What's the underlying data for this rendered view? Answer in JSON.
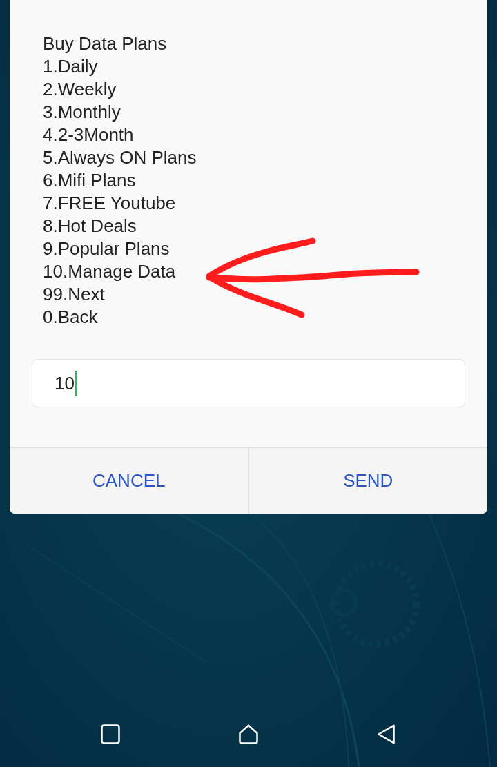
{
  "dialog": {
    "message": {
      "title": "Buy Data Plans",
      "options": [
        "1.Daily",
        "2.Weekly",
        "3.Monthly",
        "4.2-3Month",
        "5.Always ON Plans",
        "6.Mifi Plans",
        "7.FREE Youtube",
        "8.Hot Deals",
        "9.Popular Plans",
        "10.Manage Data",
        "99.Next",
        "0.Back"
      ]
    },
    "input": {
      "value": "10",
      "focused": true
    },
    "buttons": [
      {
        "label": "CANCEL"
      },
      {
        "label": "SEND"
      }
    ]
  },
  "annotations": [
    {
      "kind": "arrow"
    }
  ],
  "nav_bar": {
    "buttons": [
      {
        "kind": "recents"
      },
      {
        "kind": "home"
      },
      {
        "kind": "back"
      }
    ]
  }
}
